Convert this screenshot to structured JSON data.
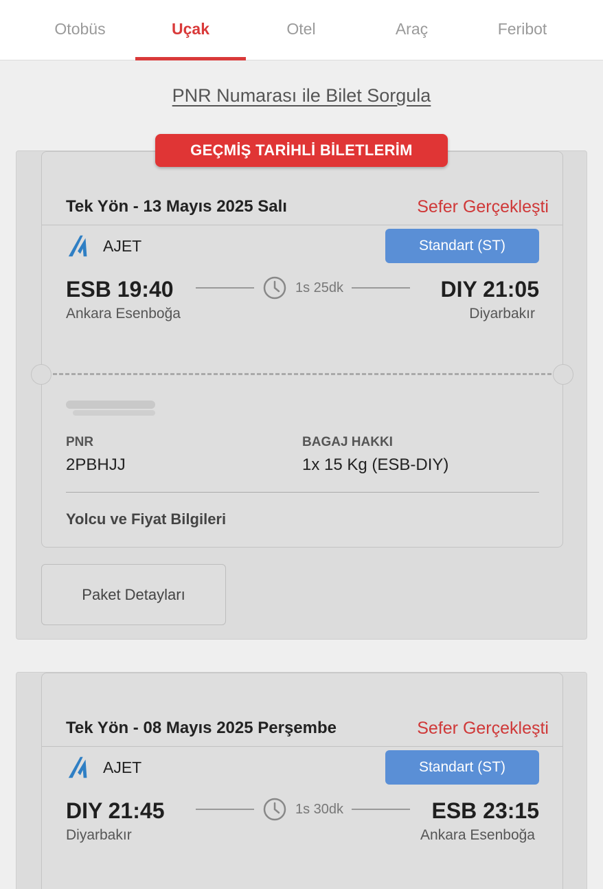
{
  "tabs": [
    {
      "label": "Otobüs",
      "active": false
    },
    {
      "label": "Uçak",
      "active": true
    },
    {
      "label": "Otel",
      "active": false
    },
    {
      "label": "Araç",
      "active": false
    },
    {
      "label": "Feribot",
      "active": false
    }
  ],
  "pnr_query_link": "PNR Numarası ile Bilet Sorgula",
  "past_tickets_badge": "GEÇMİŞ TARİHLİ BİLETLERİM",
  "colors": {
    "accent_red": "#d93a3a",
    "fare_blue": "#5a8fd6",
    "airline_logo_blue": "#2f7fc4"
  },
  "tickets": [
    {
      "trip_title": "Tek Yön - 13 Mayıs 2025 Salı",
      "status": "Sefer Gerçekleşti",
      "airline": "AJET",
      "airline_icon": "ajet-logo-icon",
      "fare_class": "Standart (ST)",
      "departure": {
        "time": "ESB 19:40",
        "city": "Ankara Esenboğa"
      },
      "duration": "1s 25dk",
      "arrival": {
        "time": "DIY 21:05",
        "city": "Diyarbakır"
      },
      "pnr_label": "PNR",
      "pnr_value": "2PBHJJ",
      "baggage_label": "BAGAJ HAKKI",
      "baggage_value": "1x 15 Kg (ESB-DIY)",
      "passenger_info_link": "Yolcu ve Fiyat Bilgileri",
      "package_details_button": "Paket Detayları"
    },
    {
      "trip_title": "Tek Yön - 08 Mayıs 2025 Perşembe",
      "status": "Sefer Gerçekleşti",
      "airline": "AJET",
      "airline_icon": "ajet-logo-icon",
      "fare_class": "Standart (ST)",
      "departure": {
        "time": "DIY 21:45",
        "city": "Diyarbakır"
      },
      "duration": "1s 30dk",
      "arrival": {
        "time": "ESB 23:15",
        "city": "Ankara Esenboğa"
      }
    }
  ]
}
